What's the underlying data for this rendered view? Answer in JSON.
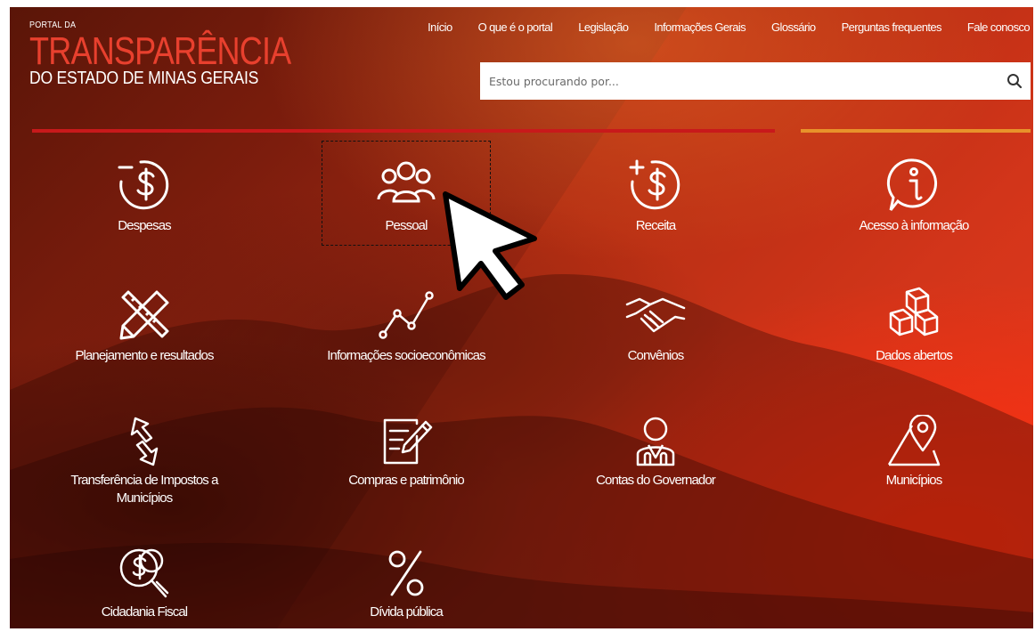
{
  "logo": {
    "line1": "PORTAL DA",
    "line2": "TRANSPARÊNCIA",
    "line3": "DO ESTADO DE MINAS GERAIS"
  },
  "nav": [
    {
      "label": "Início"
    },
    {
      "label": "O que é o portal"
    },
    {
      "label": "Legislação"
    },
    {
      "label": "Informações Gerais"
    },
    {
      "label": "Glossário"
    },
    {
      "label": "Perguntas frequentes"
    },
    {
      "label": "Fale conosco"
    }
  ],
  "search": {
    "placeholder": "Estou procurando por...",
    "icon": "search-icon"
  },
  "tiles": [
    {
      "label": "Despesas",
      "icon": "money-minus-icon"
    },
    {
      "label": "Pessoal",
      "icon": "people-group-icon"
    },
    {
      "label": "Receita",
      "icon": "money-plus-icon"
    },
    {
      "label": "Acesso à informação",
      "icon": "info-icon"
    },
    {
      "label": "Planejamento e resultados",
      "icon": "pencil-ruler-icon"
    },
    {
      "label": "Informações socioeconômicas",
      "icon": "line-chart-icon"
    },
    {
      "label": "Convênios",
      "icon": "handshake-icon"
    },
    {
      "label": "Dados abertos",
      "icon": "cubes-icon"
    },
    {
      "label": "Transferência de Impostos a Municípios",
      "icon": "transfer-arrows-icon"
    },
    {
      "label": "Compras e patrimônio",
      "icon": "document-edit-icon"
    },
    {
      "label": "Contas do Governador",
      "icon": "governor-person-icon"
    },
    {
      "label": "Municípios",
      "icon": "map-pin-icon"
    },
    {
      "label": "Cidadania Fiscal",
      "icon": "money-magnifier-icon"
    },
    {
      "label": "Dívida pública",
      "icon": "percent-icon"
    }
  ],
  "colors": {
    "logo_red": "#e8402e",
    "bar_red": "#c8191b",
    "bar_orange": "#e8922a"
  }
}
